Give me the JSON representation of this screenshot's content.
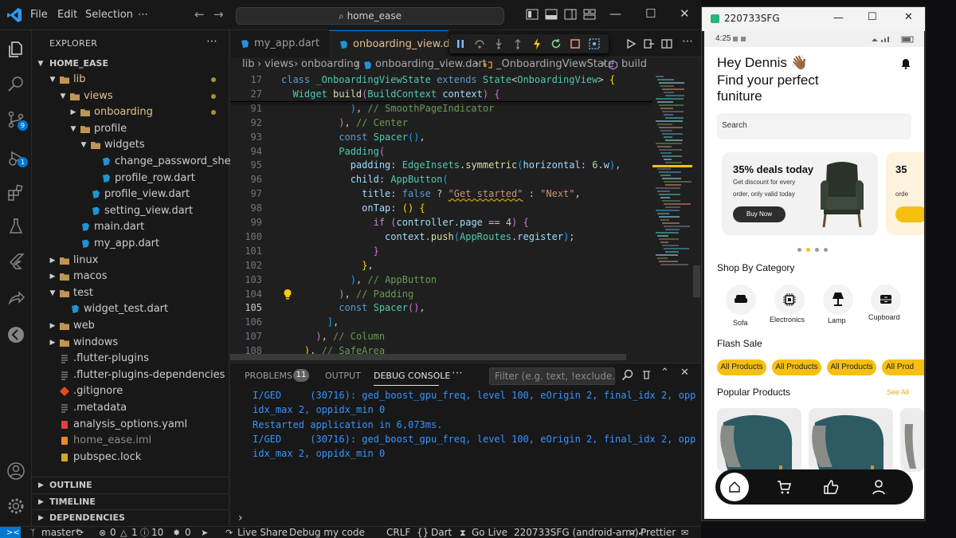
{
  "titlebar": {
    "menus": [
      "File",
      "Edit",
      "Selection",
      "⋯"
    ],
    "search": "home_ease"
  },
  "activity": {
    "source_control_badge": "9",
    "debug_badge": "1"
  },
  "explorer": {
    "header": "EXPLORER",
    "root": "HOME_EASE",
    "items": [
      {
        "label": "lib",
        "depth": 1,
        "kind": "folder-open",
        "mod": true
      },
      {
        "label": "views",
        "depth": 2,
        "kind": "folder-open",
        "mod": true
      },
      {
        "label": "onboarding",
        "depth": 3,
        "kind": "folder",
        "mod": true
      },
      {
        "label": "profile",
        "depth": 3,
        "kind": "folder-open",
        "mod": false
      },
      {
        "label": "widgets",
        "depth": 4,
        "kind": "folder-open",
        "mod": false
      },
      {
        "label": "change_password_sheet.dart",
        "depth": 5,
        "kind": "dart",
        "mod": false
      },
      {
        "label": "profile_row.dart",
        "depth": 5,
        "kind": "dart",
        "mod": false
      },
      {
        "label": "profile_view.dart",
        "depth": 4,
        "kind": "dart",
        "mod": false
      },
      {
        "label": "setting_view.dart",
        "depth": 4,
        "kind": "dart",
        "mod": false
      },
      {
        "label": "main.dart",
        "depth": 3,
        "kind": "dart",
        "mod": false
      },
      {
        "label": "my_app.dart",
        "depth": 3,
        "kind": "dart",
        "mod": false
      },
      {
        "label": "linux",
        "depth": 1,
        "kind": "folder",
        "mod": false
      },
      {
        "label": "macos",
        "depth": 1,
        "kind": "folder",
        "mod": false
      },
      {
        "label": "test",
        "depth": 1,
        "kind": "folder-open",
        "mod": false
      },
      {
        "label": "widget_test.dart",
        "depth": 2,
        "kind": "dart",
        "mod": false
      },
      {
        "label": "web",
        "depth": 1,
        "kind": "folder",
        "mod": false
      },
      {
        "label": "windows",
        "depth": 1,
        "kind": "folder",
        "mod": false
      },
      {
        "label": ".flutter-plugins",
        "depth": 1,
        "kind": "plain",
        "mod": false
      },
      {
        "label": ".flutter-plugins-dependencies",
        "depth": 1,
        "kind": "plain",
        "mod": false
      },
      {
        "label": ".gitignore",
        "depth": 1,
        "kind": "git",
        "mod": false
      },
      {
        "label": ".metadata",
        "depth": 1,
        "kind": "plain",
        "mod": false
      },
      {
        "label": "analysis_options.yaml",
        "depth": 1,
        "kind": "yaml",
        "mod": false
      },
      {
        "label": "home_ease.iml",
        "depth": 1,
        "kind": "iml",
        "mod": false
      },
      {
        "label": "pubspec.lock",
        "depth": 1,
        "kind": "lock",
        "mod": false
      }
    ],
    "sections": [
      "OUTLINE",
      "TIMELINE",
      "DEPENDENCIES"
    ]
  },
  "tabs": [
    {
      "label": "my_app.dart",
      "active": false
    },
    {
      "label": "onboarding_view.d",
      "active": true
    }
  ],
  "breadcrumb": [
    "lib",
    "views",
    "onboarding",
    "onboarding_view.dart",
    "_OnboardingViewState",
    "build"
  ],
  "code_lines": [
    {
      "n": "17",
      "sticky": true,
      "tokens": [
        [
          "kw",
          "class "
        ],
        [
          "ty",
          "_OnboardingViewState "
        ],
        [
          "kw",
          "extends "
        ],
        [
          "ty",
          "State"
        ],
        [
          "pu",
          "<"
        ],
        [
          "ty",
          "OnboardingView"
        ],
        [
          "pu",
          "> "
        ],
        [
          "b1",
          "{"
        ]
      ]
    },
    {
      "n": "27",
      "sticky": true,
      "tokens": [
        [
          "pu",
          "  "
        ],
        [
          "ty",
          "Widget "
        ],
        [
          "fn",
          "build"
        ],
        [
          "b2",
          "("
        ],
        [
          "ty",
          "BuildContext "
        ],
        [
          "pr",
          "context"
        ],
        [
          "b2",
          ")"
        ],
        [
          "pu",
          " "
        ],
        [
          "b2",
          "{"
        ]
      ]
    },
    {
      "n": "91",
      "tokens": [
        [
          "pu",
          "            "
        ],
        [
          "b3",
          ")"
        ],
        [
          "pu",
          ", "
        ],
        [
          "cm",
          "// SmoothPageIndicator"
        ]
      ]
    },
    {
      "n": "92",
      "tokens": [
        [
          "pu",
          "          "
        ],
        [
          "b2",
          ")"
        ],
        [
          "pu",
          ", "
        ],
        [
          "cm",
          "// Center"
        ]
      ]
    },
    {
      "n": "93",
      "tokens": [
        [
          "pu",
          "          "
        ],
        [
          "kw",
          "const "
        ],
        [
          "ty",
          "Spacer"
        ],
        [
          "b3",
          "()"
        ],
        [
          "pu",
          ","
        ]
      ]
    },
    {
      "n": "94",
      "tokens": [
        [
          "pu",
          "          "
        ],
        [
          "ty",
          "Padding"
        ],
        [
          "b2",
          "("
        ]
      ]
    },
    {
      "n": "95",
      "tokens": [
        [
          "pu",
          "            "
        ],
        [
          "pr",
          "padding"
        ],
        [
          "pu",
          ": "
        ],
        [
          "ty",
          "EdgeInsets"
        ],
        [
          "pu",
          "."
        ],
        [
          "fn",
          "symmetric"
        ],
        [
          "b3",
          "("
        ],
        [
          "pr",
          "horizontal"
        ],
        [
          "pu",
          ": "
        ],
        [
          "nu",
          "6"
        ],
        [
          "pu",
          "."
        ],
        [
          "pr",
          "w"
        ],
        [
          "b3",
          ")"
        ],
        [
          "pu",
          ","
        ]
      ]
    },
    {
      "n": "96",
      "tokens": [
        [
          "pu",
          "            "
        ],
        [
          "pr",
          "child"
        ],
        [
          "pu",
          ": "
        ],
        [
          "ty",
          "AppButton"
        ],
        [
          "b3",
          "("
        ]
      ]
    },
    {
      "n": "97",
      "tokens": [
        [
          "pu",
          "              "
        ],
        [
          "pr",
          "title"
        ],
        [
          "pu",
          ": "
        ],
        [
          "kw",
          "false "
        ],
        [
          "pu",
          "? "
        ],
        [
          "st",
          "\"Get started\""
        ],
        [
          "pu",
          " : "
        ],
        [
          "st",
          "\"Next\""
        ],
        [
          "pu",
          ","
        ]
      ]
    },
    {
      "n": "98",
      "tokens": [
        [
          "pu",
          "              "
        ],
        [
          "pr",
          "onTap"
        ],
        [
          "pu",
          ": "
        ],
        [
          "b1",
          "() {"
        ]
      ]
    },
    {
      "n": "99",
      "tokens": [
        [
          "pu",
          "                "
        ],
        [
          "ct",
          "if "
        ],
        [
          "b2",
          "("
        ],
        [
          "pr",
          "controller"
        ],
        [
          "pu",
          "."
        ],
        [
          "pr",
          "page"
        ],
        [
          "pu",
          " == "
        ],
        [
          "nu",
          "4"
        ],
        [
          "b2",
          ")"
        ],
        [
          "pu",
          " "
        ],
        [
          "b2",
          "{"
        ]
      ]
    },
    {
      "n": "100",
      "tokens": [
        [
          "pu",
          "                  "
        ],
        [
          "pr",
          "context"
        ],
        [
          "pu",
          "."
        ],
        [
          "fn",
          "push"
        ],
        [
          "b3",
          "("
        ],
        [
          "ty",
          "AppRoutes"
        ],
        [
          "pu",
          "."
        ],
        [
          "pr",
          "register"
        ],
        [
          "b3",
          ")"
        ],
        [
          "pu",
          ";"
        ]
      ]
    },
    {
      "n": "101",
      "tokens": [
        [
          "pu",
          "                "
        ],
        [
          "b2",
          "}"
        ]
      ]
    },
    {
      "n": "102",
      "tokens": [
        [
          "pu",
          "              "
        ],
        [
          "b1",
          "}"
        ],
        [
          "pu",
          ","
        ]
      ]
    },
    {
      "n": "103",
      "tokens": [
        [
          "pu",
          "            "
        ],
        [
          "b3",
          ")"
        ],
        [
          "pu",
          ", "
        ],
        [
          "cm",
          "// AppButton"
        ]
      ]
    },
    {
      "n": "104",
      "tokens": [
        [
          "pu",
          "          "
        ],
        [
          "b2",
          ")"
        ],
        [
          "pu",
          ", "
        ],
        [
          "cm",
          "// Padding"
        ]
      ]
    },
    {
      "n": "105",
      "tokens": [
        [
          "pu",
          "          "
        ],
        [
          "kw",
          "const "
        ],
        [
          "ty",
          "Spacer"
        ],
        [
          "b2",
          "()"
        ],
        [
          "pu",
          ","
        ]
      ]
    },
    {
      "n": "106",
      "tokens": [
        [
          "pu",
          "        "
        ],
        [
          "b3",
          "]"
        ],
        [
          "pu",
          ","
        ]
      ]
    },
    {
      "n": "107",
      "tokens": [
        [
          "pu",
          "      "
        ],
        [
          "b2",
          ")"
        ],
        [
          "pu",
          ", "
        ],
        [
          "cm",
          "// Column"
        ]
      ]
    },
    {
      "n": "108",
      "tokens": [
        [
          "pu",
          "    "
        ],
        [
          "b1",
          ")"
        ],
        [
          "pu",
          ", "
        ],
        [
          "cm",
          "// SafeArea"
        ]
      ]
    }
  ],
  "panel": {
    "tabs": [
      "PROBLEMS",
      "OUTPUT",
      "DEBUG CONSOLE"
    ],
    "problems_count": "11",
    "filter_placeholder": "Filter (e.g. text, !exclude...",
    "console": [
      "I/GED     (30716): ged_boost_gpu_freq, level 100, eOrigin 2, final_idx 2, opp",
      "idx_max 2, oppidx_min 0",
      "Restarted application in 6,073ms.",
      "I/GED     (30716): ged_boost_gpu_freq, level 100, eOrigin 2, final_idx 2, opp",
      "idx_max 2, oppidx_min 0"
    ]
  },
  "statusbar": {
    "branch": "master*",
    "errors": "0",
    "warnings": "1",
    "infos": "10",
    "ports": "0",
    "live_share": "Live Share",
    "debug": "Debug my code",
    "eol": "CRLF",
    "language": "Dart",
    "go_live": "Go Live",
    "device": "220733SFG (android-arm)",
    "prettier": "Prettier"
  },
  "emulator": {
    "title": "220733SFG",
    "time": "4:25",
    "greeting": "Hey Dennis 👋🏾",
    "headline_1": "Find your perfect",
    "headline_2": "funiture",
    "search_placeholder": "Search",
    "promo": {
      "title": "35% deals today",
      "line1": "Get discount for every",
      "line2": "order, only valid today",
      "button": "Buy Now",
      "peek_title": "35",
      "peek_line": "orde"
    },
    "category_heading": "Shop By Category",
    "categories": [
      "Sofa",
      "Electronics",
      "Lamp",
      "Cupboard"
    ],
    "flash_heading": "Flash Sale",
    "chips": [
      "All Products",
      "All Products",
      "All Products",
      "All Prod"
    ],
    "popular_heading": "Popular Products",
    "see_all": "See All"
  },
  "colors": {
    "accent": "#0078d4",
    "chip": "#f6c010",
    "promo_button": "#2d2d2d"
  }
}
